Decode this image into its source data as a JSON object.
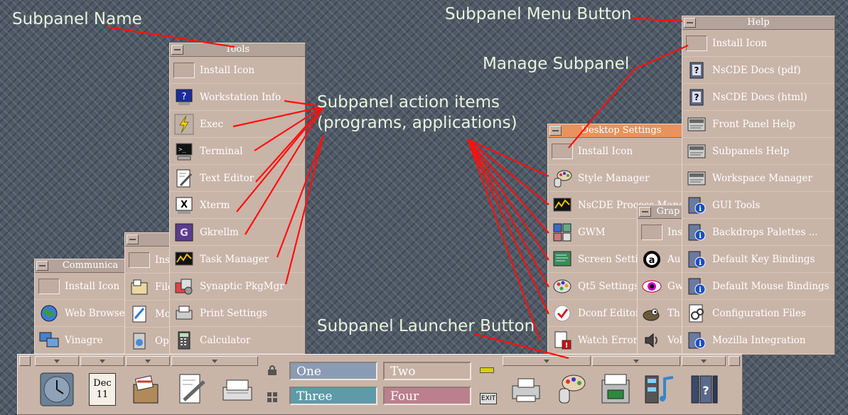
{
  "annotations": {
    "subpanel_name": "Subpanel Name",
    "menu_button": "Subpanel Menu Button",
    "manage": "Manage Subpanel",
    "actions_line1": "Subpanel action items",
    "actions_line2": "(programs, applications)",
    "launcher": "Subpanel Launcher Button"
  },
  "common": {
    "install_icon": "Install Icon"
  },
  "tools": {
    "title": "Tools",
    "items": [
      "Workstation Info",
      "Exec",
      "Terminal",
      "Text Editor",
      "Xterm",
      "Gkrellm",
      "Task Manager",
      "Synaptic PkgMgr",
      "Print Settings",
      "Calculator"
    ]
  },
  "communication": {
    "title": "Communica",
    "items": [
      "Web Browse",
      "Vinagre"
    ]
  },
  "files": {
    "title": "",
    "items": [
      "Ins",
      "File",
      "Mo",
      "Op"
    ]
  },
  "desktop": {
    "title": "Desktop Settings",
    "items": [
      "Style Manager",
      "NsCDE Process Mana",
      "GWM",
      "Screen Setti",
      "Qt5 Settings",
      "Dconf Editor",
      "Watch Errors"
    ]
  },
  "graphics": {
    "title": "Grap",
    "items": [
      "Ins",
      "Au",
      "Gw",
      "Th",
      "Vol"
    ]
  },
  "help": {
    "title": "Help",
    "items": [
      "NsCDE Docs (pdf)",
      "NsCDE Docs (html)",
      "Front Panel Help",
      "Subpanels Help",
      "Workspace Manager",
      "GUI Tools",
      "Backdrops Palettes ...",
      "Default Key Bindings",
      "Default Mouse Bindings",
      "Configuration Files",
      "Mozilla Integration"
    ]
  },
  "frontpanel": {
    "date_month": "Dec",
    "date_day": "11",
    "workspaces": [
      {
        "label": "One",
        "color": "#8a9cb3"
      },
      {
        "label": "Two",
        "color": "#c8b1a5"
      },
      {
        "label": "Three",
        "color": "#5f9aa8"
      },
      {
        "label": "Four",
        "color": "#bb7f8d"
      }
    ],
    "exit_label": "EXIT"
  }
}
